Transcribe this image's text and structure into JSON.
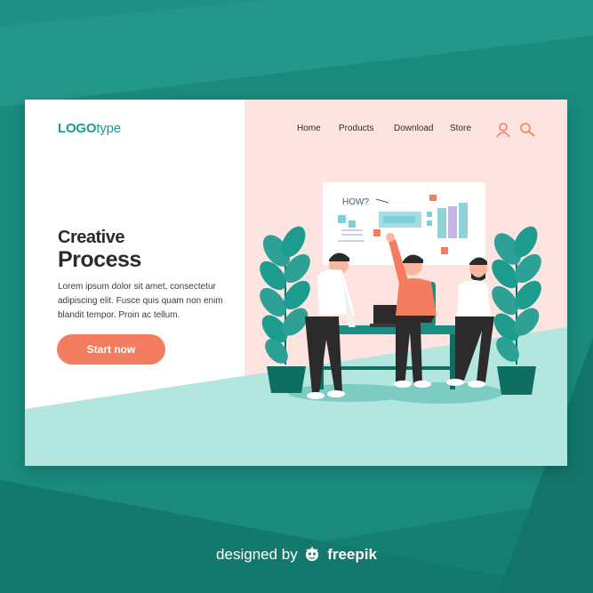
{
  "logo": {
    "bold": "LOGO",
    "thin": "type"
  },
  "nav": {
    "items": [
      "Home",
      "Products",
      "Download",
      "Store"
    ]
  },
  "header_icons": [
    "user-icon",
    "search-icon"
  ],
  "hero": {
    "title_line1": "Creative",
    "title_line2": "Process",
    "description": "Lorem ipsum dolor sit amet, consectetur adipiscing elit. Fusce quis quam non enim blandit tempor. Proin ac tellum.",
    "cta_label": "Start now"
  },
  "whiteboard": {
    "text": "HOW?"
  },
  "credit": {
    "prefix": "designed by",
    "brand": "freepik"
  },
  "colors": {
    "background": "#1a8a7d",
    "accent": "#f47c60",
    "teal": "#1c9c8d",
    "pink_panel": "#fde4e1",
    "mint_floor": "#b2e6df"
  }
}
